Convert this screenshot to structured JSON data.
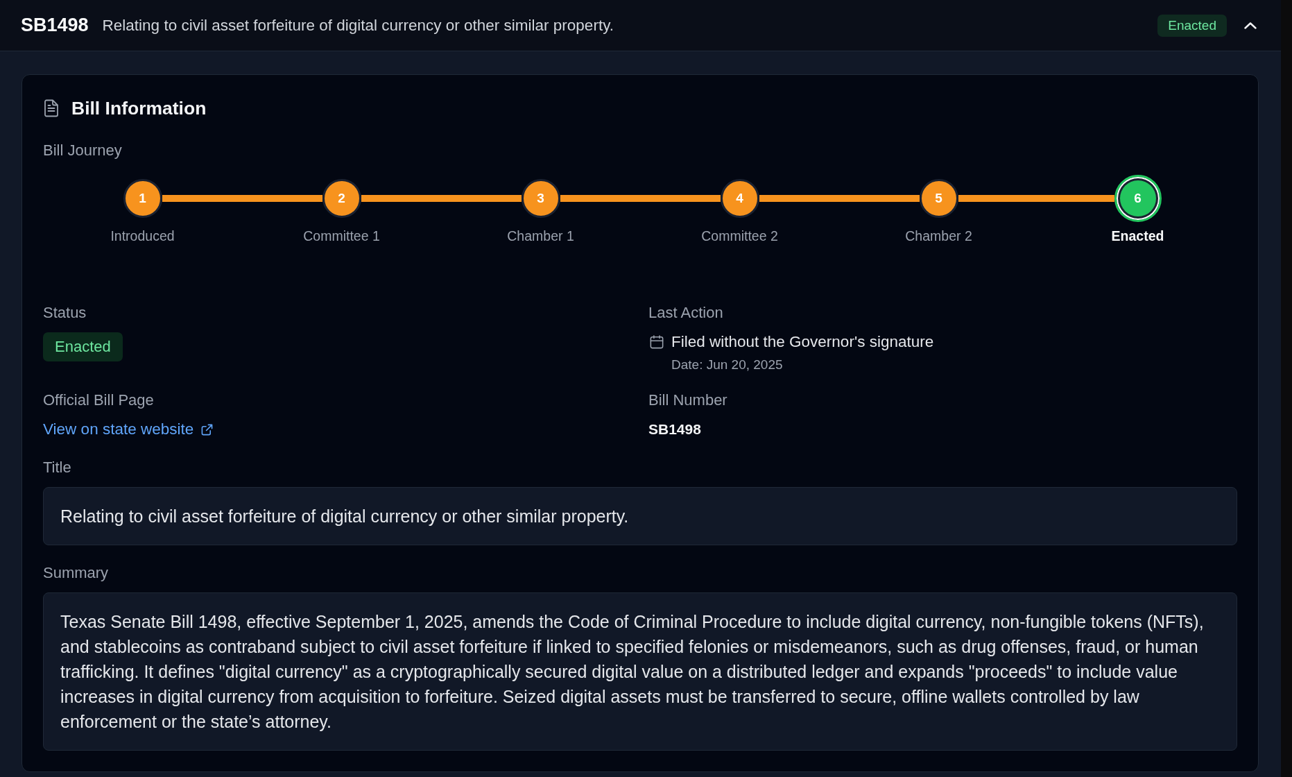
{
  "header": {
    "bill_number": "SB1498",
    "title": "Relating to civil asset forfeiture of digital currency or other similar property.",
    "status": "Enacted",
    "expanded": true
  },
  "bill_information": {
    "title": "Bill Information",
    "journey": {
      "label": "Bill Journey",
      "steps": [
        {
          "number": "1",
          "label": "Introduced",
          "completed": true,
          "current": false
        },
        {
          "number": "2",
          "label": "Committee 1",
          "completed": true,
          "current": false
        },
        {
          "number": "3",
          "label": "Chamber 1",
          "completed": true,
          "current": false
        },
        {
          "number": "4",
          "label": "Committee 2",
          "completed": true,
          "current": false
        },
        {
          "number": "5",
          "label": "Chamber 2",
          "completed": true,
          "current": false
        },
        {
          "number": "6",
          "label": "Enacted",
          "completed": true,
          "current": true
        }
      ]
    },
    "status": {
      "label": "Status",
      "value": "Enacted"
    },
    "last_action": {
      "label": "Last Action",
      "action": "Filed without the Governor's signature",
      "date": "Date: Jun 20, 2025"
    },
    "official_bill_page": {
      "label": "Official Bill Page",
      "link": "View on state website"
    },
    "bill_number": {
      "label": "Bill Number",
      "value": "SB1498"
    },
    "title_field": {
      "label": "Title",
      "value": "Relating to civil asset forfeiture of digital currency or other similar property."
    },
    "summary": {
      "label": "Summary",
      "text": "Texas Senate Bill 1498, effective September 1, 2025, amends the Code of Criminal Procedure to include digital currency, non-fungible tokens (NFTs), and stablecoins as contraband subject to civil asset forfeiture if linked to specified felonies or misdemeanors, such as drug offenses, fraud, or human trafficking. It defines \"digital currency\" as a cryptographically secured digital value on a distributed ledger and expands \"proceeds\" to include value increases in digital currency from acquisition to forfeiture. Seized digital assets must be transferred to secure, offline wallets controlled by law enforcement or the state’s attorney."
    }
  }
}
